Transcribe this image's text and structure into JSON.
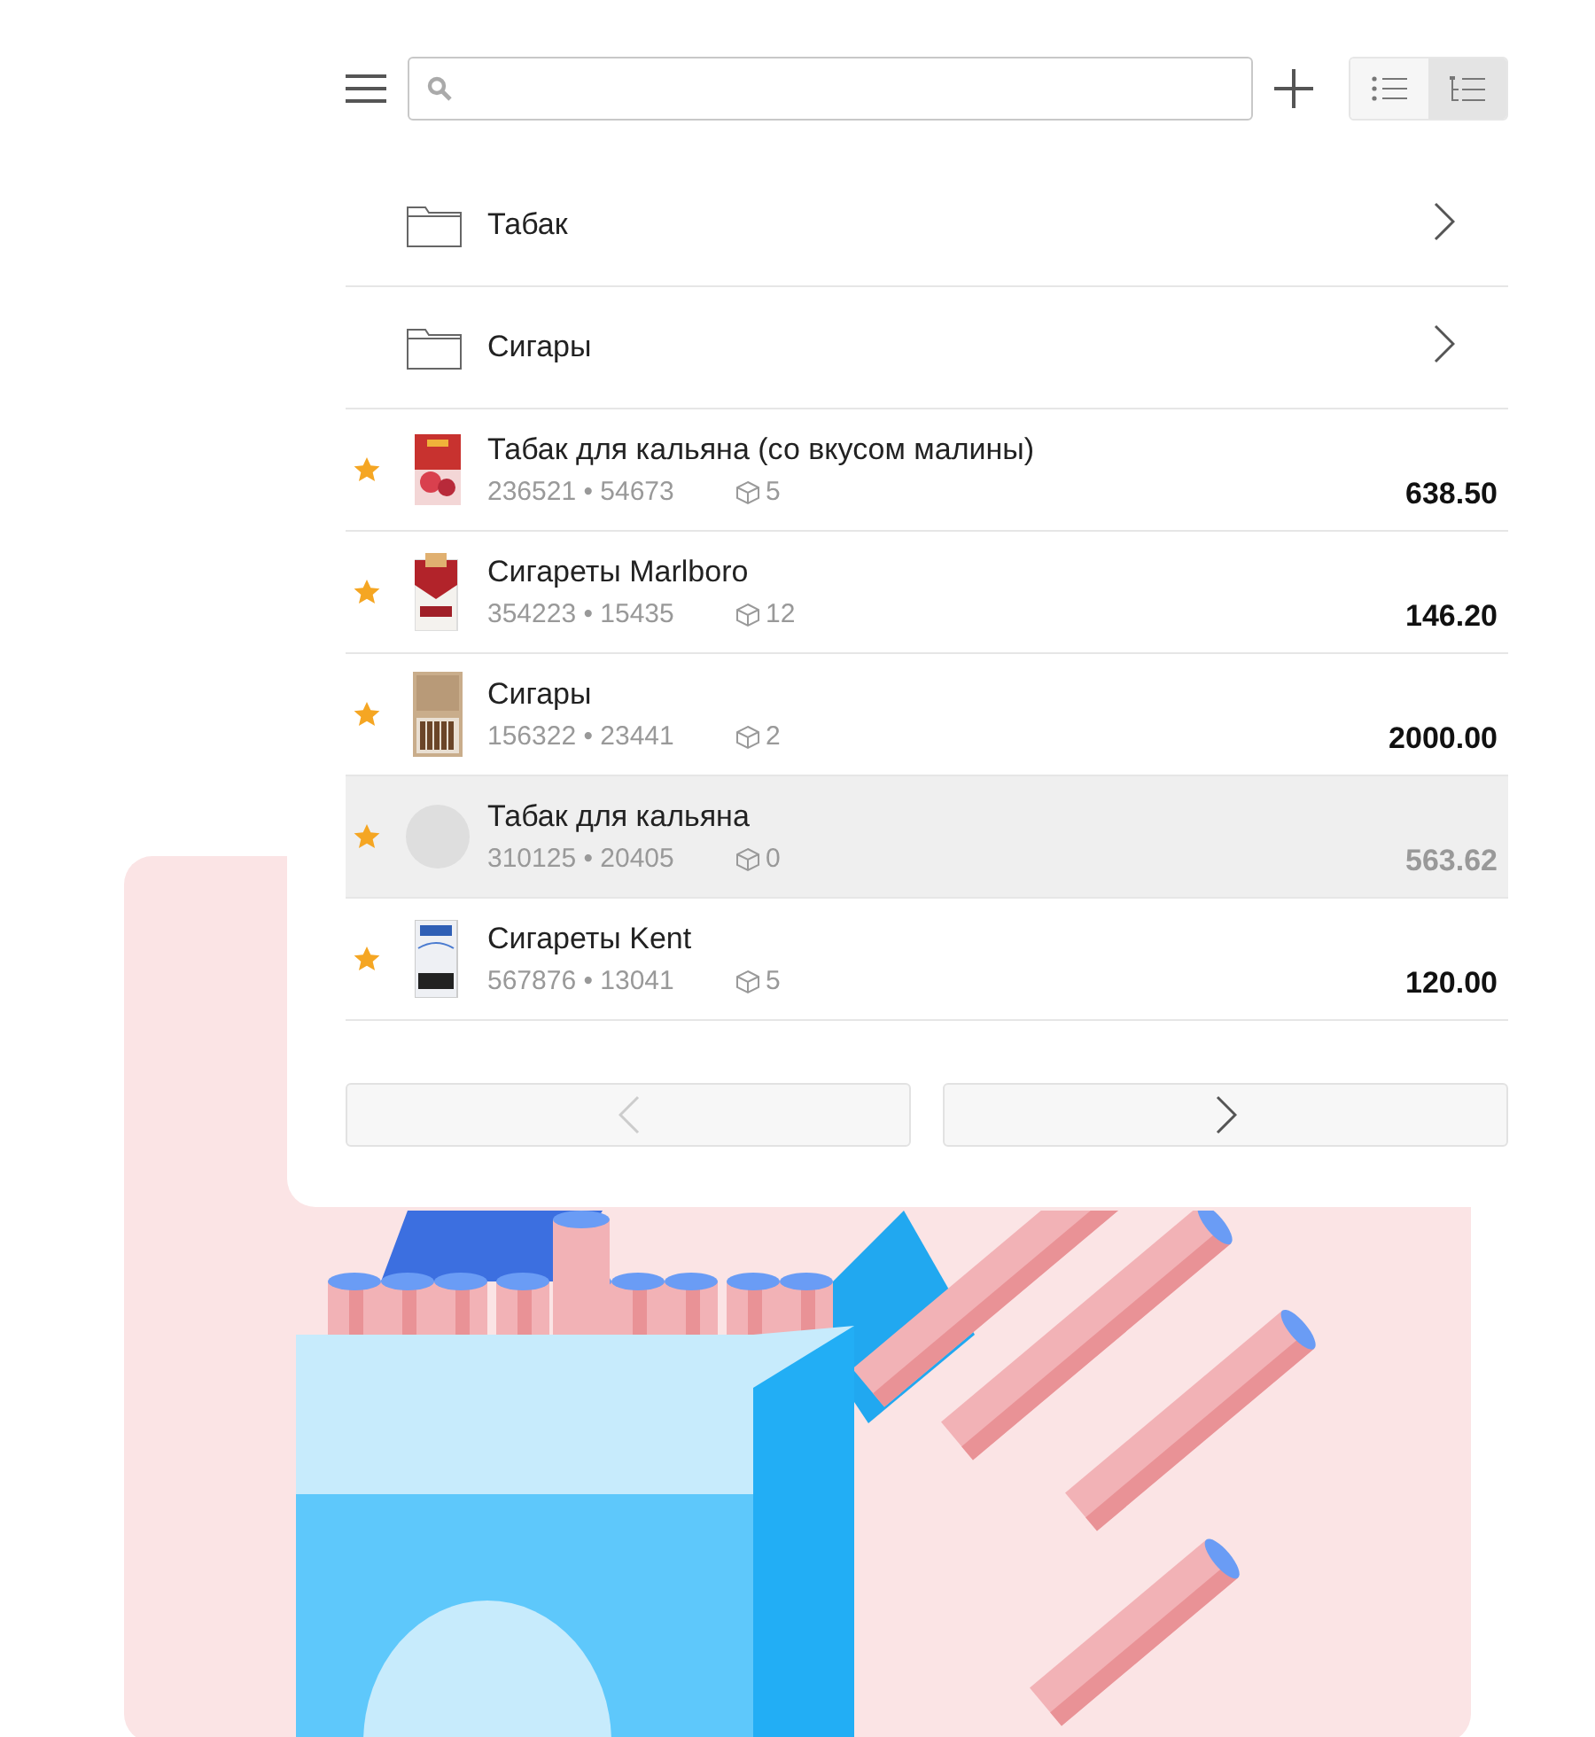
{
  "toolbar": {
    "views": [
      {
        "kind": "list",
        "selected": false
      },
      {
        "kind": "tree",
        "selected": true
      }
    ]
  },
  "folders": [
    {
      "name": "Табак"
    },
    {
      "name": "Сигары"
    }
  ],
  "items": [
    {
      "name": "Табак для кальяна (со вкусом малины)",
      "codes": "236521 • 54673",
      "stock": "5",
      "price": "638.50",
      "favorite": true,
      "kind": "hookah",
      "selected": false,
      "unavailable": false
    },
    {
      "name": "Сигареты Marlboro",
      "codes": "354223 • 15435",
      "stock": "12",
      "price": "146.20",
      "favorite": true,
      "kind": "redpack",
      "selected": false,
      "unavailable": false
    },
    {
      "name": "Сигары",
      "codes": "156322 • 23441",
      "stock": "2",
      "price": "2000.00",
      "favorite": true,
      "kind": "cigarbox",
      "selected": false,
      "unavailable": false
    },
    {
      "name": "Табак для кальяна",
      "codes": "310125 • 20405",
      "stock": "0",
      "price": "563.62",
      "favorite": true,
      "kind": "placeholder",
      "selected": true,
      "unavailable": true
    },
    {
      "name": "Сигареты Kent",
      "codes": "567876 • 13041",
      "stock": "5",
      "price": "120.00",
      "favorite": true,
      "kind": "whitepack",
      "selected": false,
      "unavailable": false
    }
  ],
  "pagination": {
    "prev_disabled": true,
    "next_disabled": false
  }
}
